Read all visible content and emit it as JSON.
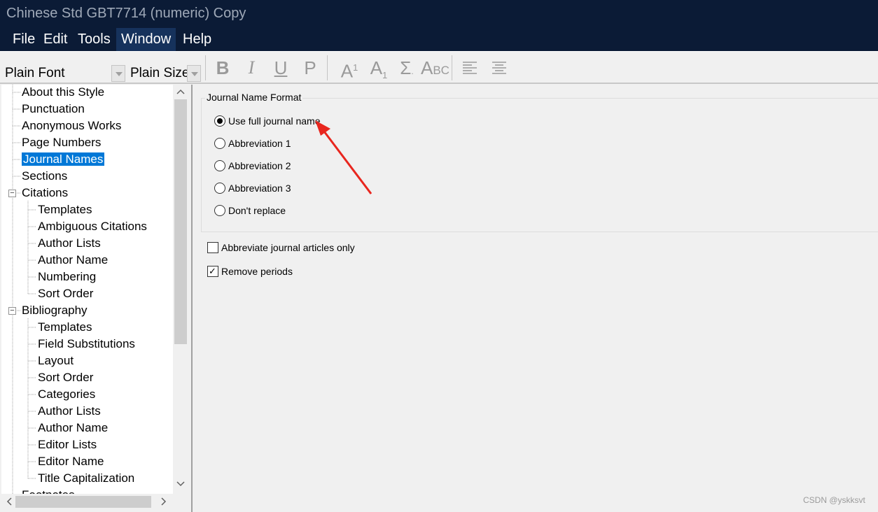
{
  "window": {
    "title": "Chinese Std GBT7714 (numeric) Copy"
  },
  "menu": {
    "file": "File",
    "edit": "Edit",
    "tools": "Tools",
    "window": "Window",
    "help": "Help"
  },
  "toolbar": {
    "font": "Plain Font",
    "size": "Plain Size",
    "bold": "B",
    "italic": "I",
    "underline": "U",
    "plain": "P",
    "superscript": "A",
    "superscript_mark": "1",
    "subscript": "A",
    "subscript_mark": "1",
    "symbol": "Σ",
    "smallcaps": "A",
    "smallcaps_rest": "BC"
  },
  "tree": [
    {
      "label": "About this Style",
      "indent": 0
    },
    {
      "label": "Punctuation",
      "indent": 0
    },
    {
      "label": "Anonymous Works",
      "indent": 0
    },
    {
      "label": "Page Numbers",
      "indent": 0
    },
    {
      "label": "Journal Names",
      "indent": 0,
      "selected": true
    },
    {
      "label": "Sections",
      "indent": 0
    },
    {
      "label": "Citations",
      "indent": 0,
      "expander": "−"
    },
    {
      "label": "Templates",
      "indent": 1
    },
    {
      "label": "Ambiguous Citations",
      "indent": 1
    },
    {
      "label": "Author Lists",
      "indent": 1
    },
    {
      "label": "Author Name",
      "indent": 1
    },
    {
      "label": "Numbering",
      "indent": 1
    },
    {
      "label": "Sort Order",
      "indent": 1
    },
    {
      "label": "Bibliography",
      "indent": 0,
      "expander": "−"
    },
    {
      "label": "Templates",
      "indent": 1
    },
    {
      "label": "Field Substitutions",
      "indent": 1
    },
    {
      "label": "Layout",
      "indent": 1
    },
    {
      "label": "Sort Order",
      "indent": 1
    },
    {
      "label": "Categories",
      "indent": 1
    },
    {
      "label": "Author Lists",
      "indent": 1
    },
    {
      "label": "Author Name",
      "indent": 1
    },
    {
      "label": "Editor Lists",
      "indent": 1
    },
    {
      "label": "Editor Name",
      "indent": 1
    },
    {
      "label": "Title Capitalization",
      "indent": 1
    },
    {
      "label": "Footnotes",
      "indent": 0
    }
  ],
  "journal_format": {
    "group_title": "Journal Name Format",
    "options": [
      {
        "label": "Use full journal name",
        "checked": true
      },
      {
        "label": "Abbreviation 1",
        "checked": false
      },
      {
        "label": "Abbreviation 2",
        "checked": false
      },
      {
        "label": "Abbreviation 3",
        "checked": false
      },
      {
        "label": "Don't replace",
        "checked": false
      }
    ]
  },
  "checkboxes": [
    {
      "label": "Abbreviate journal articles only",
      "checked": false
    },
    {
      "label": "Remove periods",
      "checked": true
    }
  ],
  "watermark": "CSDN @yskksvt",
  "colors": {
    "titlebar": "#0b1b36",
    "selection": "#0078d7",
    "annotation_arrow": "#e8261e"
  }
}
